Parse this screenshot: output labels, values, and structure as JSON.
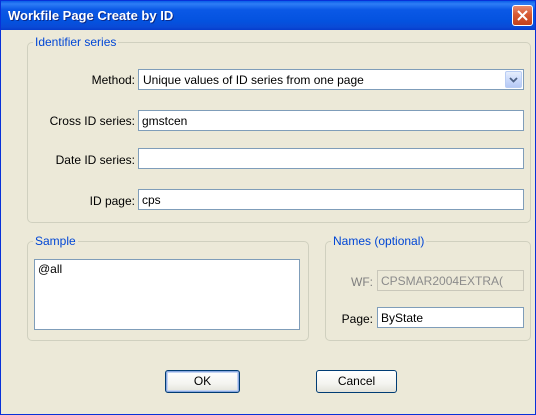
{
  "window": {
    "title": "Workfile Page Create by ID"
  },
  "identifier_series": {
    "legend": "Identifier series",
    "method_label": "Method:",
    "method_value": "Unique values of ID series from one page",
    "cross_id_label": "Cross ID series:",
    "cross_id_value": "gmstcen",
    "date_id_label": "Date ID series:",
    "date_id_value": "",
    "id_page_label": "ID page:",
    "id_page_value": "cps"
  },
  "sample": {
    "legend": "Sample",
    "value": "@all"
  },
  "names": {
    "legend": "Names (optional)",
    "wf_label": "WF:",
    "wf_value": "CPSMAR2004EXTRA(",
    "page_label": "Page:",
    "page_value": "ByState"
  },
  "buttons": {
    "ok": "OK",
    "cancel": "Cancel"
  }
}
